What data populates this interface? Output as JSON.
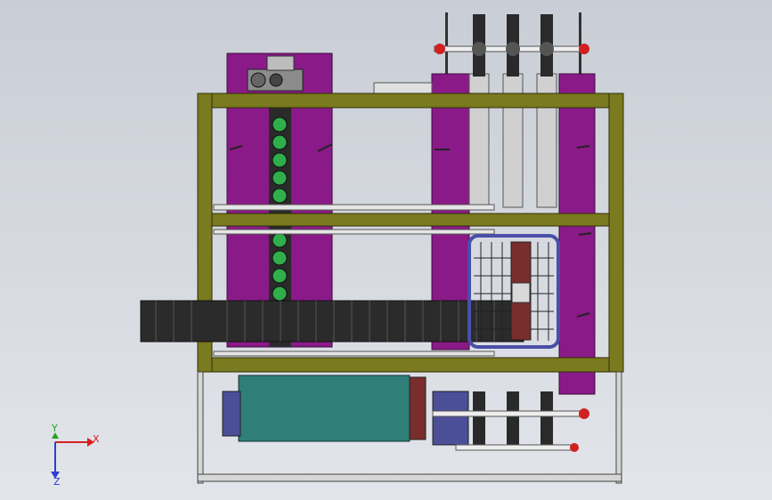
{
  "viewport": {
    "background_top": "#c9cdd5",
    "background_bottom": "#dfe2e8"
  },
  "model": {
    "colors": {
      "frame": "#7a7a1e",
      "frame_edge": "#2f2f0a",
      "plate": "#8a1a88",
      "plate_edge": "#3d0a3c",
      "drawer_box": "#2f7f78",
      "drawer_edge": "#0e3431",
      "chain": "#2f2f2f",
      "roller": "#2fae4b",
      "rail": "#d8d8d8",
      "basket": "#4a4fa8",
      "motor": "#4b4f98"
    },
    "parts": [
      "outer-frame",
      "left-purple-plate",
      "center-purple-plate",
      "right-purple-plate",
      "roller-chain",
      "cable-drag-chain",
      "wire-basket",
      "drive-box",
      "gear-stack",
      "motor"
    ]
  },
  "triad": {
    "x_label": "X",
    "y_label": "Y",
    "z_label": "Z",
    "x_color": "#d62020",
    "y_color": "#23a023",
    "z_color": "#2b3fd0"
  }
}
